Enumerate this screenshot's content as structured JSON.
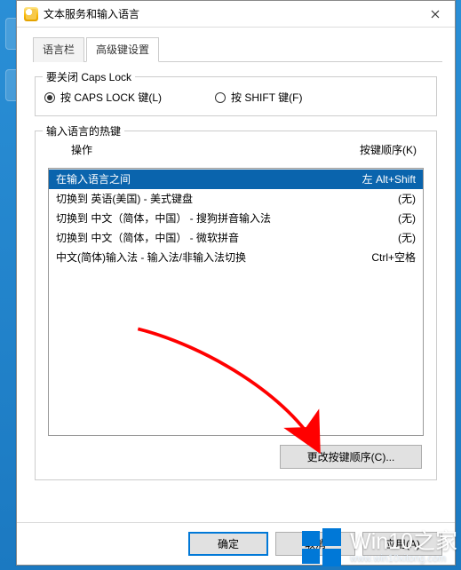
{
  "window": {
    "title": "文本服务和输入语言"
  },
  "tabs": {
    "language_bar": "语言栏",
    "advanced_keys": "高级键设置"
  },
  "caps_group": {
    "label": "要关闭 Caps Lock",
    "radio_caps": "按 CAPS LOCK 键(L)",
    "radio_shift": "按 SHIFT 键(F)"
  },
  "hotkeys_group": {
    "label": "输入语言的热键",
    "header_action": "操作",
    "header_sequence": "按键顺序(K)",
    "change_button": "更改按键顺序(C)...",
    "rows": [
      {
        "action": "在输入语言之间",
        "keys": "左 Alt+Shift",
        "selected": true
      },
      {
        "action": "切换到 英语(美国) - 美式键盘",
        "keys": "(无)",
        "selected": false
      },
      {
        "action": "切换到 中文（简体，中国） - 搜狗拼音输入法",
        "keys": "(无)",
        "selected": false
      },
      {
        "action": "切换到 中文（简体，中国） - 微软拼音",
        "keys": "(无)",
        "selected": false
      },
      {
        "action": "中文(简体)输入法 - 输入法/非输入法切换",
        "keys": "Ctrl+空格",
        "selected": false
      }
    ]
  },
  "buttons": {
    "ok": "确定",
    "cancel": "取消",
    "apply": "应用(A)"
  },
  "watermark": {
    "brand": "Win10之家",
    "url": "www.win10xitong.com"
  },
  "colors": {
    "selection": "#0a64ad",
    "accent": "#0078d7",
    "arrow": "#ff0000"
  }
}
